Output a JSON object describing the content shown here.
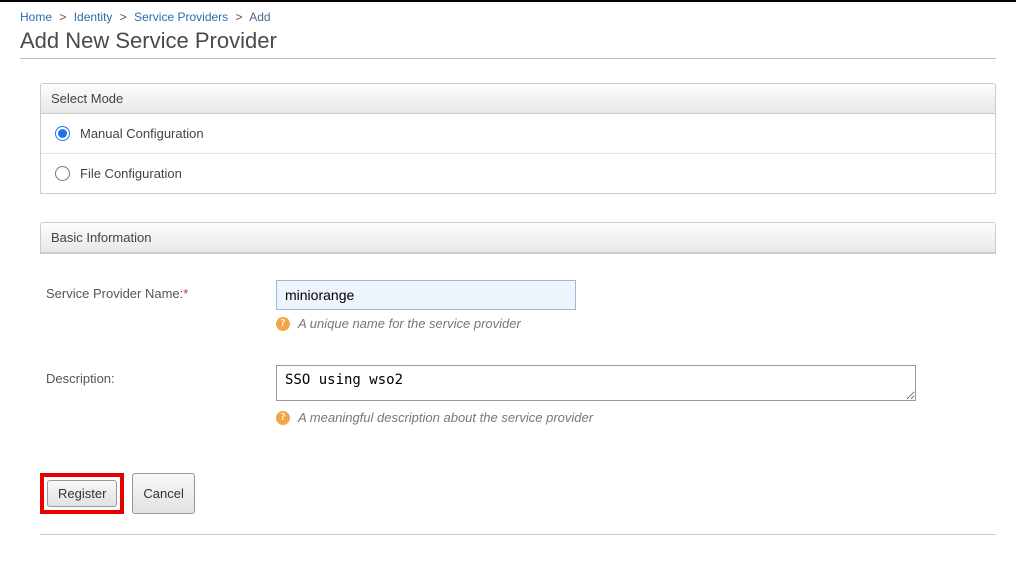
{
  "breadcrumb": {
    "home": "Home",
    "identity": "Identity",
    "sp": "Service Providers",
    "add": "Add"
  },
  "page_title": "Add New Service Provider",
  "mode_section": {
    "header": "Select Mode",
    "manual": "Manual Configuration",
    "file": "File Configuration"
  },
  "basic_section": {
    "header": "Basic Information",
    "name_label": "Service Provider Name:",
    "name_value": "miniorange",
    "name_hint": "A unique name for the service provider",
    "desc_label": "Description:",
    "desc_value": "SSO using wso2",
    "desc_hint": "A meaningful description about the service provider"
  },
  "buttons": {
    "register": "Register",
    "cancel": "Cancel"
  }
}
